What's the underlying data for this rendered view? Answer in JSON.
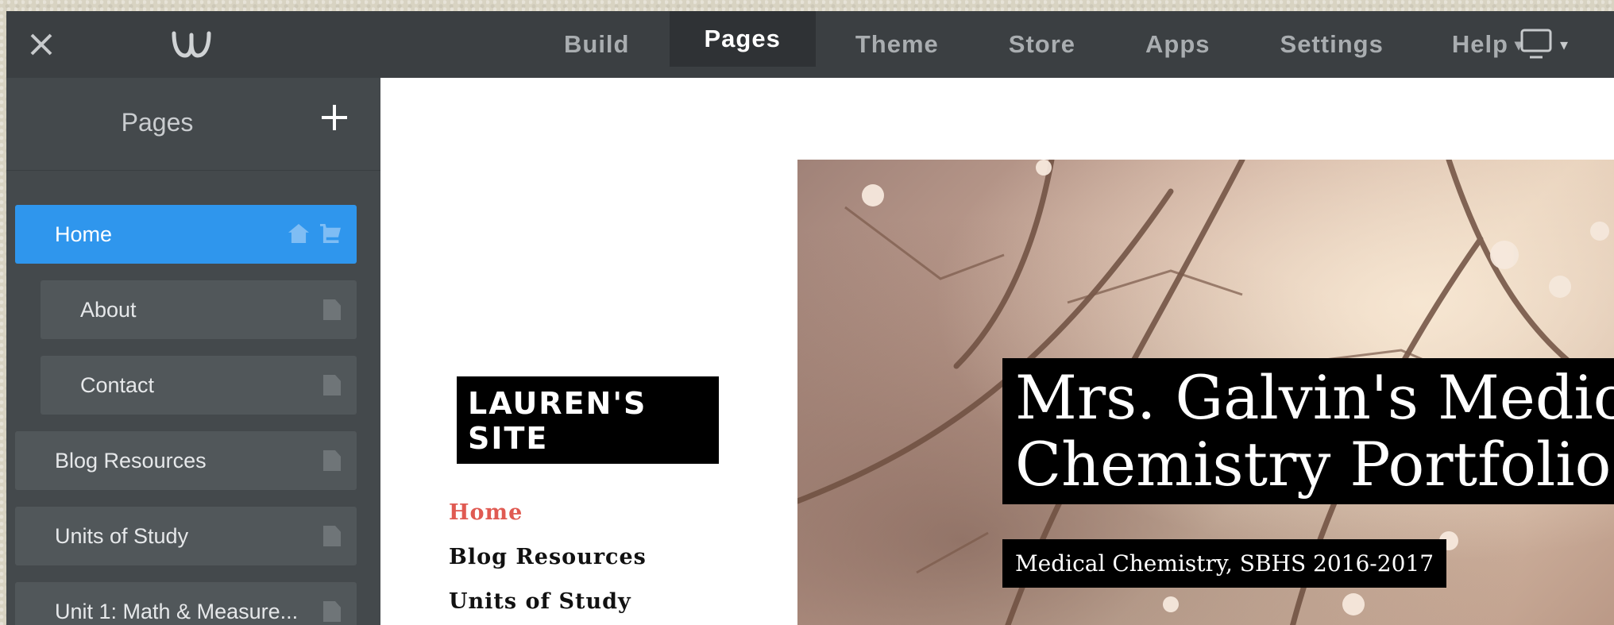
{
  "topbar": {
    "nav": [
      {
        "label": "Build",
        "active": false
      },
      {
        "label": "Pages",
        "active": true
      },
      {
        "label": "Theme",
        "active": false
      },
      {
        "label": "Store",
        "active": false
      },
      {
        "label": "Apps",
        "active": false
      },
      {
        "label": "Settings",
        "active": false
      },
      {
        "label": "Help",
        "active": false
      }
    ],
    "icons": {
      "close": "close-icon",
      "logo": "weebly-logo",
      "device": "desktop-device-icon"
    }
  },
  "sidebar": {
    "title": "Pages",
    "add_icon": "plus-icon",
    "items": [
      {
        "label": "Home",
        "active": true,
        "indent": false,
        "icons": [
          "home-icon",
          "cart-icon"
        ]
      },
      {
        "label": "About",
        "active": false,
        "indent": true,
        "icons": [
          "page-icon"
        ]
      },
      {
        "label": "Contact",
        "active": false,
        "indent": true,
        "icons": [
          "page-icon"
        ]
      },
      {
        "label": "Blog Resources",
        "active": false,
        "indent": false,
        "icons": [
          "page-icon"
        ]
      },
      {
        "label": "Units of Study",
        "active": false,
        "indent": false,
        "icons": [
          "page-icon"
        ]
      },
      {
        "label": "Unit 1: Math & Measure...",
        "active": false,
        "indent": false,
        "icons": [
          "page-icon"
        ]
      }
    ],
    "active_color": "#2f96ed"
  },
  "site": {
    "logo_text": "LAUREN'S SITE",
    "nav": [
      "Home",
      "Blog Resources",
      "Units of Study"
    ],
    "nav_current_color": "#e05a52",
    "hero": {
      "title_line1": "Mrs. Galvin's Medic",
      "title_line2": "Chemistry Portfolio",
      "subtitle": "Medical Chemistry, SBHS 2016-2017"
    }
  }
}
